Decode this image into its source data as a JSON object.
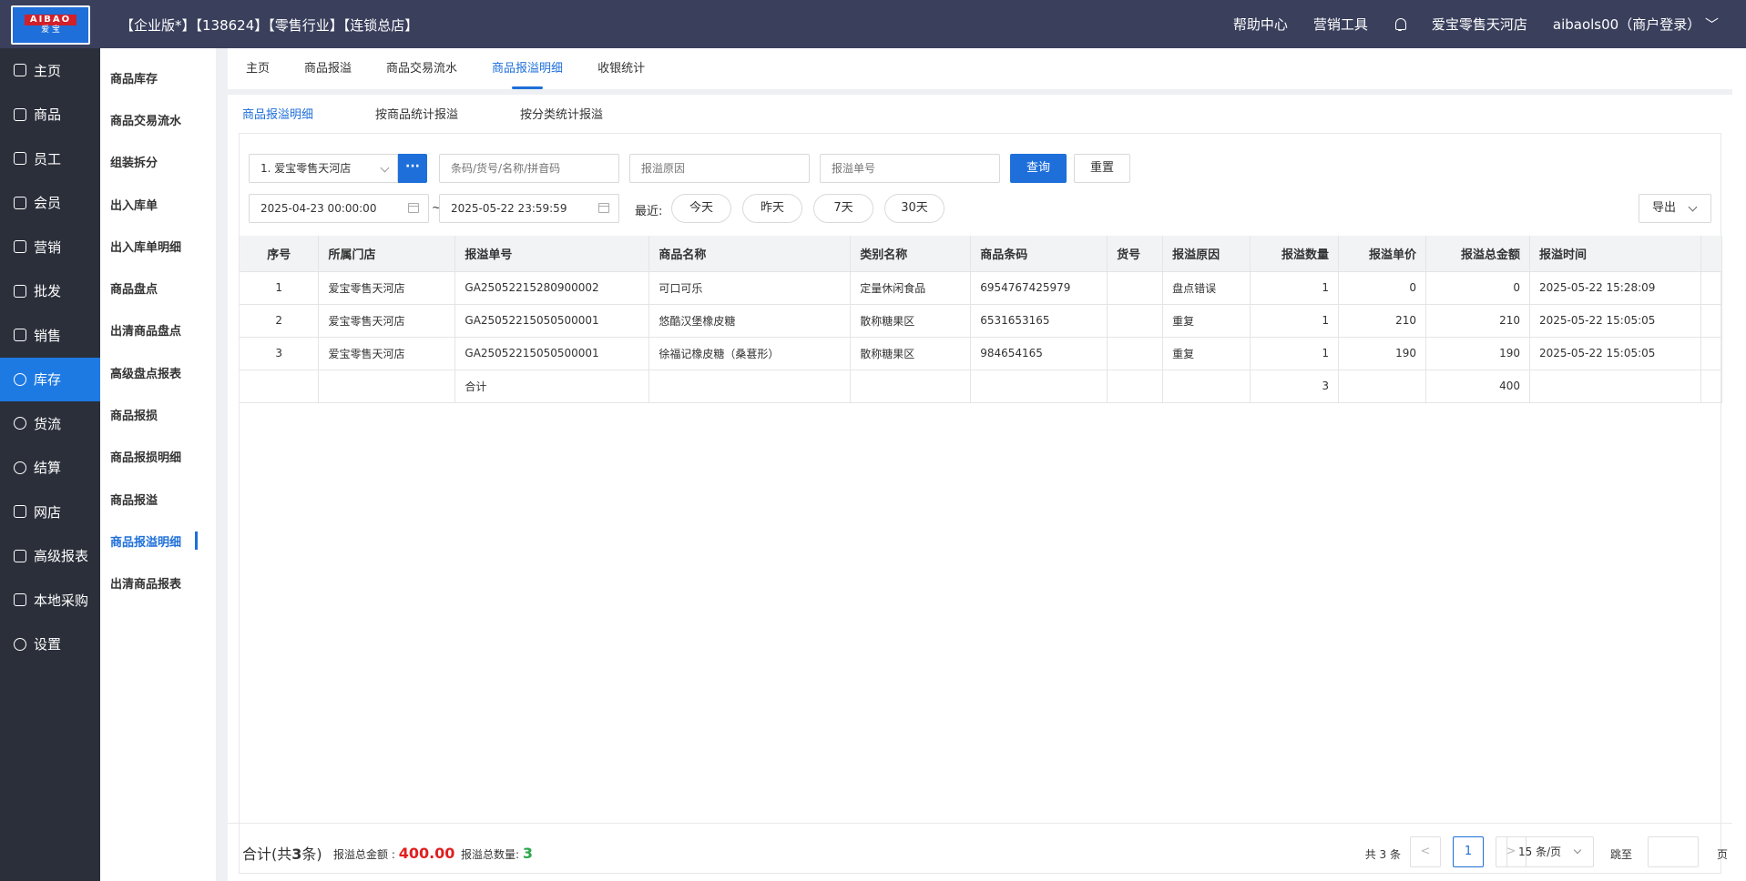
{
  "header": {
    "logo_top": "AIBAO",
    "logo_bottom": "爱 宝",
    "title": "【企业版*】【138624】【零售行业】【连锁总店】",
    "help": "帮助中心",
    "marketing_tools": "营销工具",
    "store": "爱宝零售天河店",
    "user": "aibaols00（商户登录）"
  },
  "leftnav": [
    {
      "label": "主页",
      "icon": "home-icon"
    },
    {
      "label": "商品",
      "icon": "product-icon"
    },
    {
      "label": "员工",
      "icon": "staff-icon"
    },
    {
      "label": "会员",
      "icon": "member-icon"
    },
    {
      "label": "营销",
      "icon": "marketing-icon"
    },
    {
      "label": "批发",
      "icon": "wholesale-icon"
    },
    {
      "label": "销售",
      "icon": "sales-icon"
    },
    {
      "label": "库存",
      "icon": "inventory-icon"
    },
    {
      "label": "货流",
      "icon": "logistics-icon"
    },
    {
      "label": "结算",
      "icon": "settlement-icon"
    },
    {
      "label": "网店",
      "icon": "shop-icon"
    },
    {
      "label": "高级报表",
      "icon": "report-icon"
    },
    {
      "label": "本地采购",
      "icon": "purchase-icon"
    },
    {
      "label": "设置",
      "icon": "settings-icon"
    }
  ],
  "subnav": [
    "商品库存",
    "商品交易流水",
    "组装拆分",
    "出入库单",
    "出入库单明细",
    "商品盘点",
    "出清商品盘点",
    "高级盘点报表",
    "商品报损",
    "商品报损明细",
    "商品报溢",
    "商品报溢明细",
    "出清商品报表"
  ],
  "tabs": [
    "主页",
    "商品报溢",
    "商品交易流水",
    "商品报溢明细",
    "收银统计"
  ],
  "subtabs": [
    "商品报溢明细",
    "按商品统计报溢",
    "按分类统计报溢"
  ],
  "filters": {
    "store_select": "1. 爱宝零售天河店",
    "more": "···",
    "barcode_placeholder": "条码/货号/名称/拼音码",
    "reason_placeholder": "报溢原因",
    "order_placeholder": "报溢单号",
    "query": "查询",
    "reset": "重置",
    "start_date": "2025-04-23 00:00:00",
    "tilde": "~",
    "end_date": "2025-05-22 23:59:59",
    "recent": "最近:",
    "today": "今天",
    "yesterday": "昨天",
    "d7": "7天",
    "d30": "30天",
    "export": "导出"
  },
  "table": {
    "headers": [
      "序号",
      "所属门店",
      "报溢单号",
      "商品名称",
      "类别名称",
      "商品条码",
      "货号",
      "报溢原因",
      "报溢数量",
      "报溢单价",
      "报溢总金额",
      "报溢时间"
    ],
    "rows": [
      [
        "1",
        "爱宝零售天河店",
        "GA25052215280900002",
        "可口可乐",
        "定量休闲食品",
        "6954767425979",
        "",
        "盘点错误",
        "1",
        "0",
        "0",
        "2025-05-22 15:28:09"
      ],
      [
        "2",
        "爱宝零售天河店",
        "GA25052215050500001",
        "悠酷汉堡橡皮糖",
        "散称糖果区",
        "6531653165",
        "",
        "重复",
        "1",
        "210",
        "210",
        "2025-05-22 15:05:05"
      ],
      [
        "3",
        "爱宝零售天河店",
        "GA25052215050500001",
        "徐福记橡皮糖（桑葚形）",
        "散称糖果区",
        "984654165",
        "",
        "重复",
        "1",
        "190",
        "190",
        "2025-05-22 15:05:05"
      ]
    ],
    "total_row": [
      "",
      "",
      "合计",
      "",
      "",
      "",
      "",
      "",
      "3",
      "",
      "400",
      ""
    ]
  },
  "footer": {
    "sum_prefix": "合计(共",
    "sum_count": "3",
    "sum_suffix": "条)",
    "amount_label": "报溢总金额 :",
    "amount_value": "400.00",
    "qty_label": "报溢总数量:",
    "qty_value": "3",
    "total": "共 3 条",
    "prev": "<",
    "page": "1",
    "next": ">",
    "page_size": "15 条/页",
    "jump_label": "跳至",
    "page_label": "页"
  }
}
